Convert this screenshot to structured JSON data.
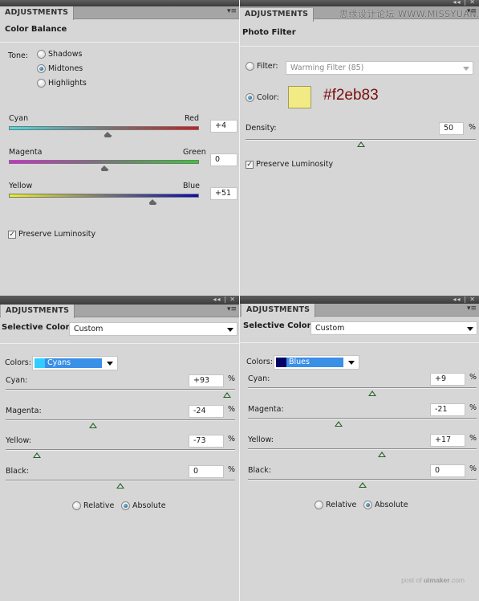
{
  "panel_tab_label": "ADJUSTMENTS",
  "panel_controls": "◂◂ | ✕",
  "panel_menu_glyph": "▾≡",
  "color_balance": {
    "title": "Color Balance",
    "tone_label": "Tone:",
    "tones": [
      {
        "label": "Shadows",
        "selected": false
      },
      {
        "label": "Midtones",
        "selected": true
      },
      {
        "label": "Highlights",
        "selected": false
      }
    ],
    "sliders": [
      {
        "left": "Cyan",
        "right": "Red",
        "value": "+4",
        "numeric": 4,
        "from": "#3fe0e8",
        "to": "#d11a1a"
      },
      {
        "left": "Magenta",
        "right": "Green",
        "value": "0",
        "numeric": 0,
        "from": "#e021e0",
        "to": "#2ed12e"
      },
      {
        "left": "Yellow",
        "right": "Blue",
        "value": "+51",
        "numeric": 51,
        "from": "#f0f020",
        "to": "#0a0ab8"
      }
    ],
    "preserve_luminosity": {
      "label": "Preserve Luminosity",
      "checked": true
    }
  },
  "photo_filter": {
    "title": "Photo Filter",
    "filter_label": "Filter:",
    "filter_value": "Warming Filter (85)",
    "filter_selected": false,
    "color_label": "Color:",
    "color_selected": true,
    "color_swatch": "#f2eb83",
    "color_hex_annotation": "#f2eb83",
    "density_label": "Density:",
    "density_value": "50",
    "density_percent": 50,
    "percent_sign": "%",
    "preserve_luminosity": {
      "label": "Preserve Luminosity",
      "checked": true
    }
  },
  "selective_color_cyans": {
    "title": "Selective Color",
    "preset": "Custom",
    "colors_label": "Colors:",
    "color_name": "Cyans",
    "color_chip": "#33ccff",
    "sliders": [
      {
        "label": "Cyan:",
        "value": "+93",
        "numeric": 93
      },
      {
        "label": "Magenta:",
        "value": "-24",
        "numeric": -24
      },
      {
        "label": "Yellow:",
        "value": "-73",
        "numeric": -73
      },
      {
        "label": "Black:",
        "value": "0",
        "numeric": 0
      }
    ],
    "percent_sign": "%",
    "method_options": [
      {
        "label": "Relative",
        "selected": false
      },
      {
        "label": "Absolute",
        "selected": true
      }
    ]
  },
  "selective_color_blues": {
    "title": "Selective Color",
    "preset": "Custom",
    "colors_label": "Colors:",
    "color_name": "Blues",
    "color_chip": "#000066",
    "sliders": [
      {
        "label": "Cyan:",
        "value": "+9",
        "numeric": 9
      },
      {
        "label": "Magenta:",
        "value": "-21",
        "numeric": -21
      },
      {
        "label": "Yellow:",
        "value": "+17",
        "numeric": 17
      },
      {
        "label": "Black:",
        "value": "0",
        "numeric": 0
      }
    ],
    "percent_sign": "%",
    "method_options": [
      {
        "label": "Relative",
        "selected": false
      },
      {
        "label": "Absolute",
        "selected": true
      }
    ]
  },
  "watermarks": {
    "top": "思缘设计论坛 WWW.MISSYUAN.COM",
    "bottom_prefix": "post of ",
    "bottom_brand": "uimaker",
    "bottom_suffix": ".com"
  }
}
